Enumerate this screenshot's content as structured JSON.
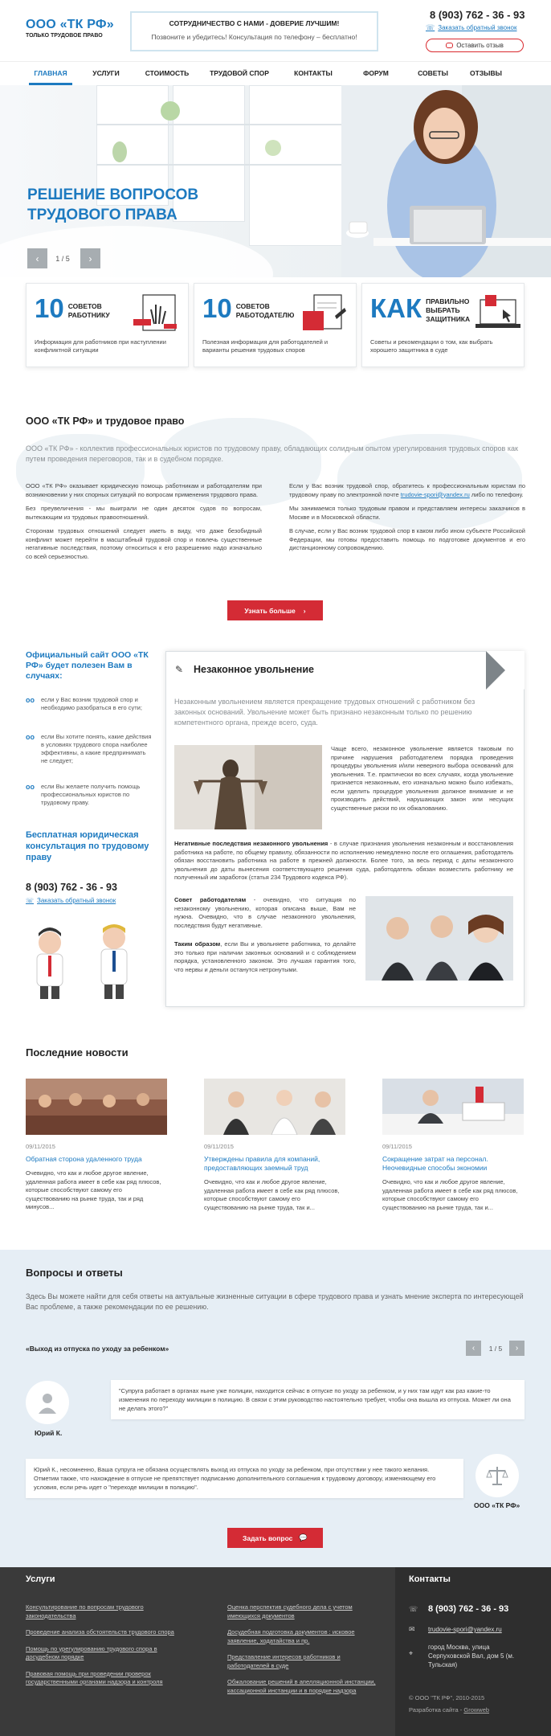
{
  "header": {
    "logo_title": "ООО «ТК РФ»",
    "logo_sub": "ТОЛЬКО ТРУДОВОЕ ПРАВО",
    "slogan_main": "СОТРУДНИЧЕСТВО С НАМИ - ДОВЕРИЕ ЛУЧШИМ!",
    "slogan_sub": "Позвоните и убедитесь! Консультация по телефону – бесплатно!",
    "phone": "8 (903) 762 - 36 - 93",
    "callback": "Заказать обратный звонок",
    "review": "Оставить отзыв"
  },
  "nav": [
    "ГЛАВНАЯ",
    "УСЛУГИ",
    "СТОИМОСТЬ",
    "ТРУДОВОЙ СПОР",
    "КОНТАКТЫ",
    "ФОРУМ",
    "СОВЕТЫ",
    "ОТЗЫВЫ"
  ],
  "hero": {
    "title_1": "РЕШЕНИЕ ВОПРОСОВ",
    "title_2": "ТРУДОВОГО ПРАВА",
    "pager": "1 / 5"
  },
  "features": [
    {
      "big": "10",
      "label": "СОВЕТОВ РАБОТНИКУ",
      "desc": "Информация для работников при наступлении конфликтной ситуации"
    },
    {
      "big": "10",
      "label": "СОВЕТОВ РАБОТОДАТЕЛЮ",
      "desc": "Полезная информация для работодателей и варианты решения трудовых споров"
    },
    {
      "big": "КАК",
      "label": "ПРАВИЛЬНО ВЫБРАТЬ ЗАЩИТНИКА",
      "desc": "Советы и рекомендации о том, как выбрать хорошего защитника в суде"
    }
  ],
  "about": {
    "title": "ООО «ТК РФ» и трудовое право",
    "lead": "ООО «ТК РФ» - коллектив профессиональных юристов по трудовому праву, обладающих солидным опытом урегулирования трудовых споров как путем проведения переговоров, так и в судебном порядке.",
    "left_p1": "ООО «ТК РФ» оказывает юридическую помощь работникам и работодателям при возникновении у них спорных ситуаций по вопросам применения трудового права.",
    "left_p2": "Без преувеличения - мы выиграли не один десяток судов по вопросам, вытекающим из трудовых правоотношений.",
    "left_p3": "Сторонам трудовых отношений следует иметь в виду, что даже безобидный конфликт может перейти в масштабный трудовой спор и повлечь существенные негативные последствия, поэтому относиться к его разрешению надо изначально со всей серьезностью.",
    "right_p1_a": "Если у Вас возник трудовой спор, обратитесь к профессиональным юристам по трудовому праву по электронной почте ",
    "right_email": "trudovie-spori@yandex.ru",
    "right_p1_b": " либо по телефону.",
    "right_p2": "Мы занимаемся только трудовым правом и представляем интересы заказчиков в Москве и в Московской области.",
    "right_p3": "В случае, если у Вас возник трудовой спор в каком либо ином субъекте Российской Федерации, мы готовы предоставить помощь по подготовке документов и его дистанционному сопровождению.",
    "more": "Узнать больше"
  },
  "sidebar": {
    "title": "Официальный сайт ООО «ТК РФ» будет полезен Вам в случаях:",
    "items": [
      "если у Вас возник трудовой спор и необходимо разобраться в его сути;",
      "если Вы хотите понять, какие действия в условиях трудового спора наиболее эффективны, а какие предпринимать не следует;",
      "если Вы желаете получить помощь профессиональных юристов по трудовому праву."
    ],
    "title2": "Бесплатная юридическая консультация по трудовому праву",
    "phone": "8 (903) 762 - 36 - 93",
    "callback": "Заказать обратный звонок"
  },
  "article": {
    "title": "Незаконное увольнение",
    "lead": "Незаконным увольнением является прекращение трудовых отношений с работником без законных оснований. Увольнение может быть признано незаконным только по решению компетентного органа, прежде всего, суда.",
    "p1": "Чаще всего, незаконное увольнение является таковым по причине нарушения работодателем порядка проведения процедуры увольнения и/или неверного выбора оснований для увольнения. Т.е. практически во всех случаях, когда увольнение признается незаконным, его изначально можно было избежать, если уделить процедуре увольнения должное внимание и не производить действий, нарушающих закон или несущих существенные риски по их обжалованию.",
    "p2_b": "Негативные последствия незаконного увольнения",
    "p2": " - в случае признания увольнения незаконным и восстановления работника на работе, по общему правилу, обязанности по исполнению немедленно после его оглашения, работодатель обязан восстановить работника на работе в прежней должности. Более того, за весь период с даты незаконного увольнения до даты вынесения соответствующего решения суда, работодатель обязан возместить работнику не полученный им заработок (статья 234 Трудового кодекса РФ).",
    "p3_b": "Совет работодателям",
    "p3": " - очевидно, что ситуация по незаконному увольнению, которая описана выше, Вам не нужна. Очевидно, что в случае незаконного увольнения, последствия будут негативные.",
    "p4_b": "Таким образом",
    "p4": ", если Вы и увольняете работника, то делайте это только при наличии законных оснований и с соблюдением порядка, установленного законом. Это лучшая гарантия того, что нервы и деньги останутся нетронутыми."
  },
  "news": {
    "title": "Последние новости",
    "items": [
      {
        "date": "09/11/2015",
        "title": "Обратная сторона удаленного труда",
        "text": "Очевидно, что как и любое другое явление, удаленная работа имеет в себе как ряд плюсов, которые способствуют самому его существованию на рынке труда, так и ряд минусов..."
      },
      {
        "date": "09/11/2015",
        "title": "Утверждены правила для компаний, предоставляющих заемный труд",
        "text": "Очевидно, что как и любое другое явление, удаленная работа имеет в себе как ряд плюсов, которые способствуют самому его существованию на рынке труда, так и..."
      },
      {
        "date": "09/11/2015",
        "title": "Сокращение затрат на персонал. Неочевидные способы экономии",
        "text": "Очевидно, что как и любое другое явление, удаленная работа имеет в себе как ряд плюсов, которые способствуют самому его существованию на рынке труда, так и..."
      }
    ]
  },
  "qa": {
    "title": "Вопросы и ответы",
    "lead": "Здесь Вы можете найти для себя ответы на актуальные жизненные ситуации в сфере трудового права и узнать мнение эксперта по интересующей Вас проблеме, а также рекомендации по ее решению.",
    "question_title": "«Выход из отпуска по уходу за ребенком»",
    "pager": "1 / 5",
    "question": "\"Супруга работает в органах ныне уже полиции, находится сейчас в отпуске по уходу за ребенком, и у них там идут как раз какие-то изменения по переходу милиции в полицию. В связи с этим руководство настоятельно требует, чтобы она вышла из отпуска. Может ли она не делать этого?\"",
    "asker": "Юрий К.",
    "answer": "Юрий К., несомненно, Ваша супруга не обязана осуществлять выход из отпуска по уходу за ребенком, при отсутствии у нее такого желания. Отметим также, что нахождение в отпуске не препятствует подписанию дополнительного соглашения к трудовому договору, изменяющему его условия, если речь идет о \"переходе милиции в полицию\".",
    "answerer": "ООО «ТК РФ»",
    "ask_btn": "Задать вопрос"
  },
  "footer": {
    "services_title": "Услуги",
    "services_left": [
      "Консультирование по вопросам трудового законодательства",
      "Проведение анализа обстоятельств трудового спора",
      "Помощь по урегулированию трудового спора в досудебном порядке",
      "Правовая помощь при проведении проверок государственными органами надзора и контроля"
    ],
    "services_right": [
      "Оценка перспектив судебного дела с учетом имеющихся документов",
      "Досудебная подготовка документов : исковое заявление, ходатайства и пр.",
      "Представление интересов работников и работодателей в суде",
      "Обжалование решений в апелляционной инстанции, кассационной инстанции и в порядке надзора"
    ],
    "contacts_title": "Контакты",
    "phone": "8 (903) 762 - 36 - 93",
    "email": "trudovie-spori@yandex.ru",
    "address": "город Москва, улица Серпуховской Вал, дом 5 (м. Тульская)",
    "copyright": "© ООО \"ТК РФ\", 2010-2015",
    "dev_label": "Разработка сайта - ",
    "dev_link": "Growweb"
  },
  "colors": {
    "brand": "#1d7ac0",
    "accent_red": "#d42b35",
    "footer": "#3a3a3a"
  }
}
